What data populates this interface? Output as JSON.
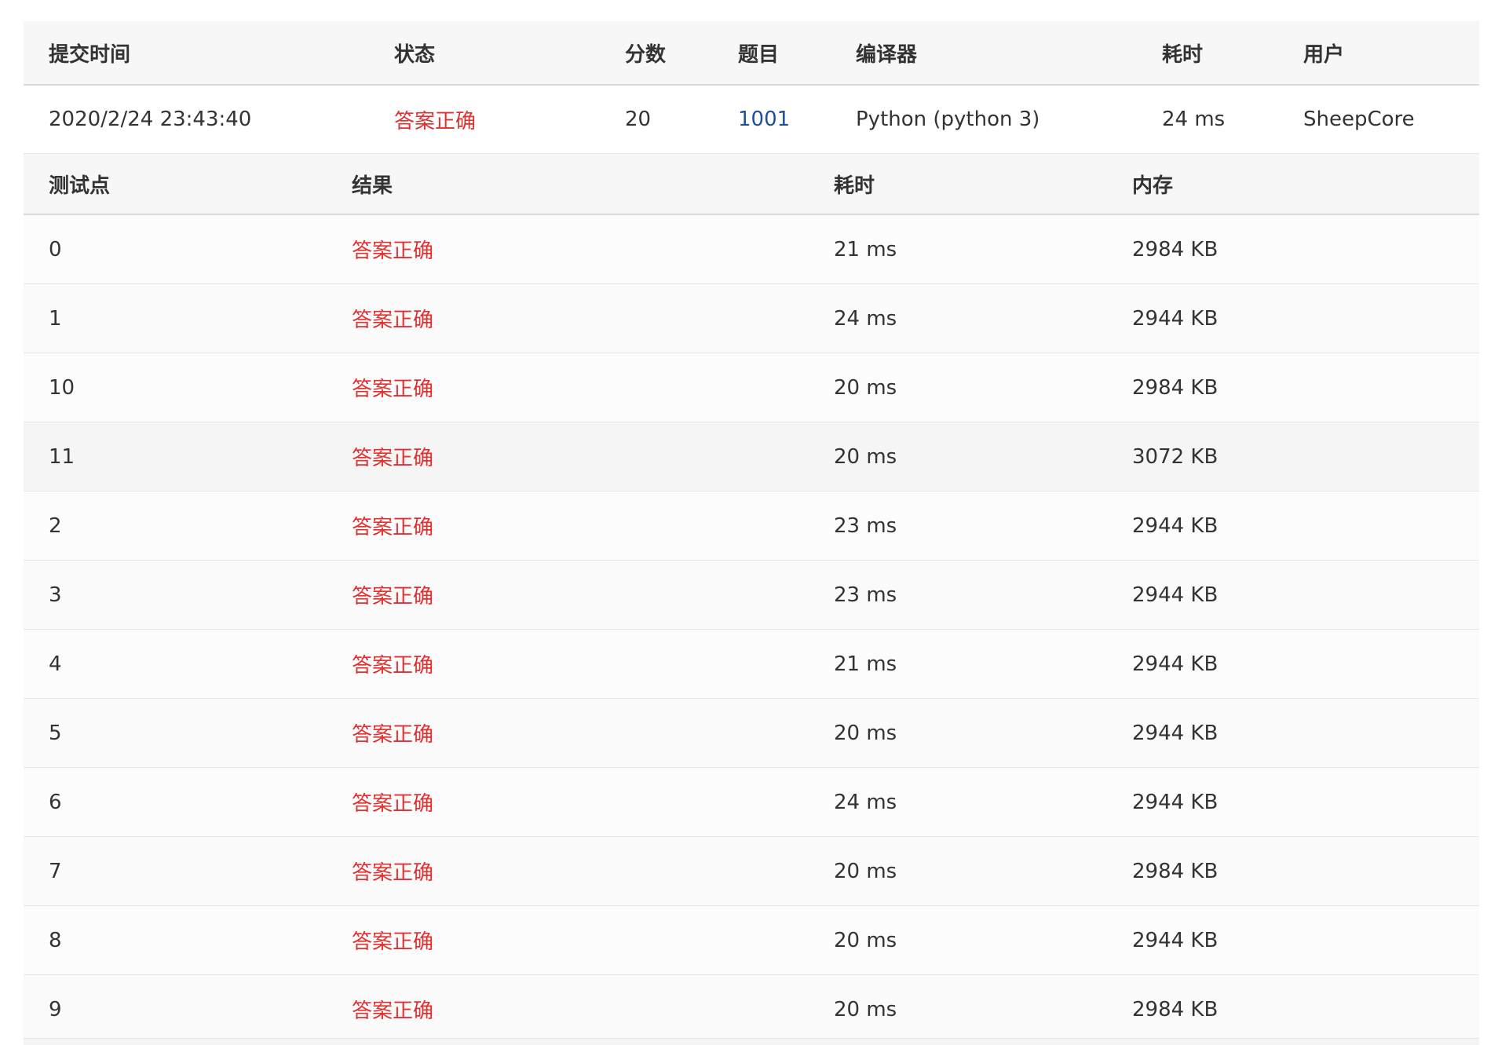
{
  "submission": {
    "headers": {
      "time": "提交时间",
      "status": "状态",
      "score": "分数",
      "problem": "题目",
      "compiler": "编译器",
      "duration": "耗时",
      "user": "用户"
    },
    "row": {
      "time": "2020/2/24 23:43:40",
      "status": "答案正确",
      "score": "20",
      "problem": "1001",
      "compiler": "Python (python 3)",
      "duration": "24 ms",
      "user": "SheepCore"
    }
  },
  "cases": {
    "headers": {
      "case": "测试点",
      "result": "结果",
      "duration": "耗时",
      "memory": "内存"
    },
    "rows": [
      {
        "case": "0",
        "result": "答案正确",
        "duration": "21 ms",
        "memory": "2984 KB"
      },
      {
        "case": "1",
        "result": "答案正确",
        "duration": "24 ms",
        "memory": "2944 KB"
      },
      {
        "case": "10",
        "result": "答案正确",
        "duration": "20 ms",
        "memory": "2984 KB"
      },
      {
        "case": "11",
        "result": "答案正确",
        "duration": "20 ms",
        "memory": "3072 KB"
      },
      {
        "case": "2",
        "result": "答案正确",
        "duration": "23 ms",
        "memory": "2944 KB"
      },
      {
        "case": "3",
        "result": "答案正确",
        "duration": "23 ms",
        "memory": "2944 KB"
      },
      {
        "case": "4",
        "result": "答案正确",
        "duration": "21 ms",
        "memory": "2944 KB"
      },
      {
        "case": "5",
        "result": "答案正确",
        "duration": "20 ms",
        "memory": "2944 KB"
      },
      {
        "case": "6",
        "result": "答案正确",
        "duration": "24 ms",
        "memory": "2944 KB"
      },
      {
        "case": "7",
        "result": "答案正确",
        "duration": "20 ms",
        "memory": "2984 KB"
      },
      {
        "case": "8",
        "result": "答案正确",
        "duration": "20 ms",
        "memory": "2944 KB"
      },
      {
        "case": "9",
        "result": "答案正确",
        "duration": "20 ms",
        "memory": "2984 KB"
      }
    ]
  },
  "colors": {
    "accepted": "#e0302f",
    "link": "#1f4e9c",
    "header_bg": "#f7f7f7"
  }
}
